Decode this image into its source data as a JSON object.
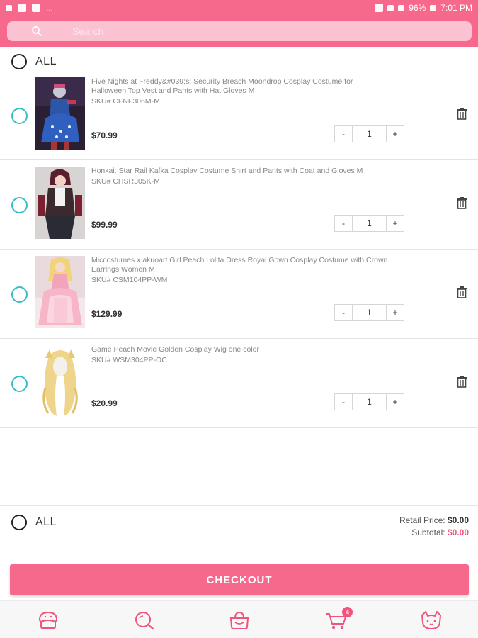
{
  "status_bar": {
    "battery": "96%",
    "time": "7:01 PM",
    "more": "..."
  },
  "search": {
    "placeholder": "Search"
  },
  "cart": {
    "select_all_label": "ALL",
    "items": [
      {
        "title": "Five Nights at Freddy&#039;s: Security Breach Moondrop Cosplay Costume for Halloween Top Vest and Pants with Hat Gloves M",
        "sku": "SKU# CFNF306M-M",
        "price": "$70.99",
        "quantity": "1"
      },
      {
        "title": "Honkai: Star Rail Kafka Cosplay Costume Shirt and Pants with Coat and Gloves M",
        "sku": "SKU# CHSR305K-M",
        "price": "$99.99",
        "quantity": "1"
      },
      {
        "title": "Miccostumes x akuoart Girl Peach Lolita Dress Royal Gown Cosplay Costume with Crown Earrings Women M",
        "sku": "SKU# CSM104PP-WM",
        "price": "$129.99",
        "quantity": "1"
      },
      {
        "title": "Game Peach Movie Golden Cosplay Wig one color",
        "sku": "SKU# WSM304PP-OC",
        "price": "$20.99",
        "quantity": "1"
      }
    ],
    "stepper_minus": "-",
    "stepper_plus": "+"
  },
  "summary": {
    "select_all_label": "ALL",
    "retail_label": "Retail Price:",
    "retail_value": "$0.00",
    "subtotal_label": "Subtotal:",
    "subtotal_value": "$0.00"
  },
  "checkout_label": "CHECKOUT",
  "bottom_nav": {
    "cart_badge": "4",
    "items": [
      "home-icon",
      "search-icon",
      "bag-icon",
      "cart-icon",
      "cat-profile-icon"
    ]
  },
  "colors": {
    "brand_pink": "#f7698c",
    "accent_teal": "#37bfc6",
    "price_pink": "#f0537c"
  }
}
